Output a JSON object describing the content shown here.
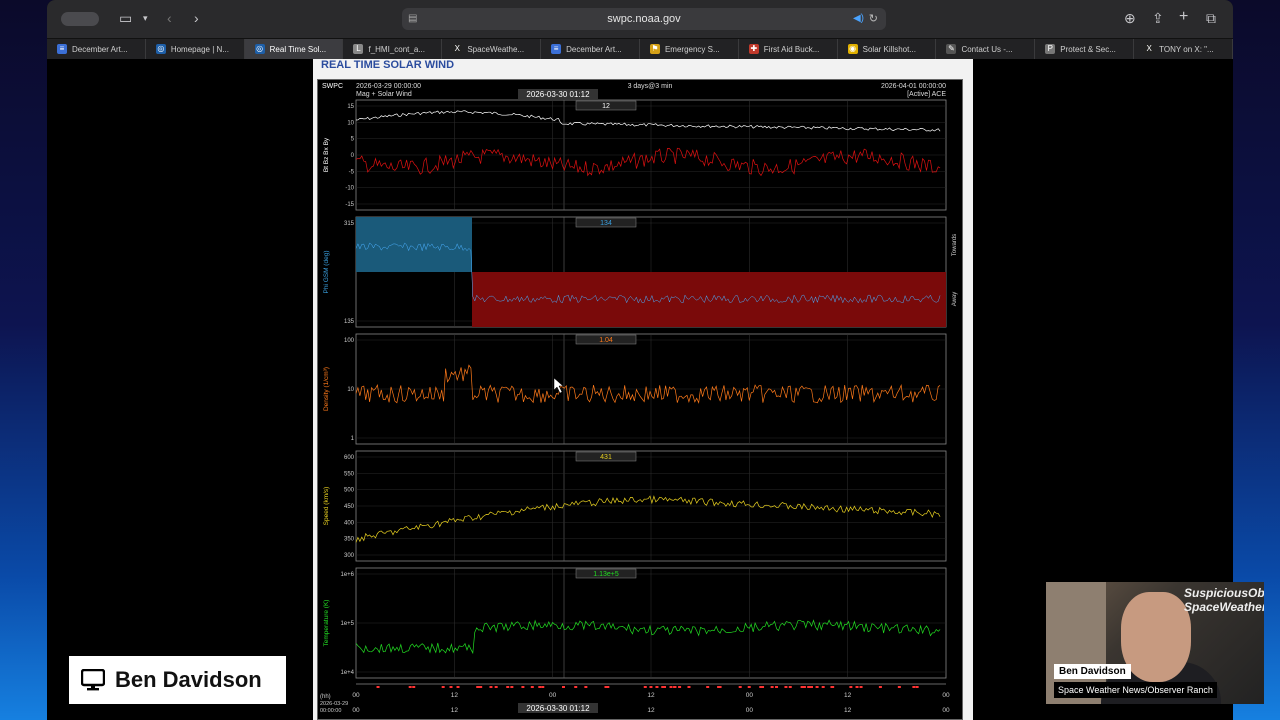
{
  "browser": {
    "url": "swpc.noaa.gov",
    "tabs": [
      {
        "label": "December Art...",
        "color": "#3b6fd6",
        "glyph": "≡"
      },
      {
        "label": "Homepage | N...",
        "color": "#1e5fa8",
        "glyph": "◎"
      },
      {
        "label": "Real Time Sol...",
        "color": "#1e5fa8",
        "glyph": "◎"
      },
      {
        "label": "f_HMI_cont_a...",
        "color": "#888888",
        "glyph": "L"
      },
      {
        "label": "SpaceWeathe...",
        "color": "#222222",
        "glyph": "X"
      },
      {
        "label": "December Art...",
        "color": "#3b6fd6",
        "glyph": "≡"
      },
      {
        "label": "Emergency S...",
        "color": "#d4a017",
        "glyph": "⚑"
      },
      {
        "label": "First Aid Buck...",
        "color": "#c0392b",
        "glyph": "✚"
      },
      {
        "label": "Solar Killshot...",
        "color": "#e0b000",
        "glyph": "◉"
      },
      {
        "label": "Contact Us -...",
        "color": "#555555",
        "glyph": "✎"
      },
      {
        "label": "Protect & Sec...",
        "color": "#777777",
        "glyph": "P"
      },
      {
        "label": "TONY on X: \"...",
        "color": "#222222",
        "glyph": "X"
      }
    ],
    "active_tab": 2
  },
  "page": {
    "title": "REAL TIME SOLAR WIND"
  },
  "plot": {
    "org": "SWPC",
    "start": "2026-03-29 00:00:00",
    "subtitle": "Mag + Solar Wind",
    "cursor_time": "2026-03-30 01:12",
    "span": "3 days@3 min",
    "end": "2026-04-01 00:00:00",
    "source": "[Active] ACE",
    "x_label_hh": "(hh)",
    "x_start_date": "2026-03-29",
    "x_start_time": "00:00:00",
    "x_ticks": [
      "00",
      "12",
      "00",
      "12",
      "00",
      "12",
      "00"
    ],
    "panels": [
      {
        "label": "Bt  Bz  Bx  By",
        "readout": "12",
        "color": "#ffffff",
        "ticks": [
          "15",
          "10",
          "5",
          "0",
          "-5",
          "-10",
          "-15"
        ]
      },
      {
        "label": "Phi GSM (deg)",
        "readout": "134",
        "color": "#3aa0e0",
        "ticks": [
          "315",
          "135"
        ],
        "right_labels": [
          "Towards",
          "Away"
        ]
      },
      {
        "label": "Density (1/cm³)",
        "readout": "1.04",
        "color": "#ff7a1a",
        "ticks": [
          "100",
          "10",
          "1"
        ]
      },
      {
        "label": "Speed (km/s)",
        "readout": "431",
        "color": "#e8d020",
        "ticks": [
          "600",
          "550",
          "500",
          "450",
          "400",
          "350",
          "300"
        ]
      },
      {
        "label": "Temperature (K)",
        "readout": "1.13e+5",
        "color": "#22dd22",
        "ticks": [
          "1e+6",
          "1e+5",
          "1e+4"
        ]
      }
    ]
  },
  "overlay": {
    "presenter": "Ben Davidson",
    "webcam_name": "Ben Davidson",
    "webcam_show": "Space Weather News/Observer Ranch",
    "sign_text": "SuspiciousObservers SpaceWeather"
  }
}
